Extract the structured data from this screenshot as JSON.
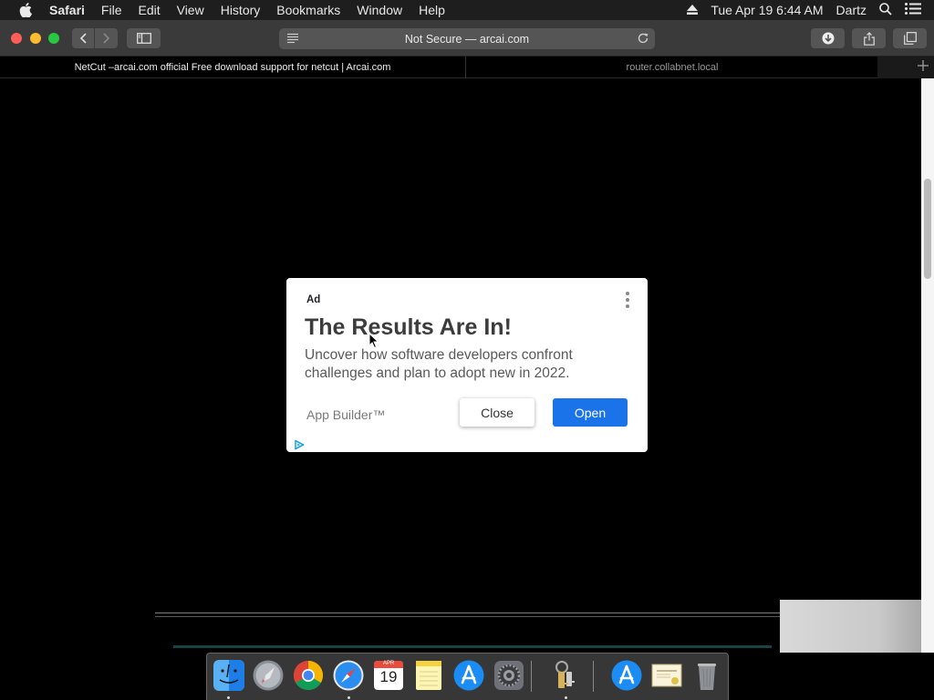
{
  "menubar": {
    "app_name": "Safari",
    "menus": [
      "File",
      "Edit",
      "View",
      "History",
      "Bookmarks",
      "Window",
      "Help"
    ],
    "datetime": "Tue Apr 19  6:44 AM",
    "user": "Dartz"
  },
  "toolbar": {
    "address_text": "Not Secure — arcai.com"
  },
  "tabs": [
    {
      "title": "NetCut –arcai.com official Free download support for netcut | Arcai.com",
      "active": true
    },
    {
      "title": "router.collabnet.local",
      "active": false
    }
  ],
  "ad": {
    "label": "Ad",
    "title": "The Results Are In!",
    "body": "Uncover how software developers confront challenges and plan to adopt new in 2022.",
    "brand": "App Builder™",
    "close_label": "Close",
    "open_label": "Open",
    "open_color": "#1a73e8"
  },
  "dock": {
    "apps": [
      "finder-icon",
      "launchpad-icon",
      "chrome-icon",
      "safari-icon",
      "calendar-icon",
      "notes-icon",
      "app-store-icon",
      "system-preferences-icon",
      "keychain-access-icon",
      "app-store-downloads-icon",
      "certificate-icon",
      "trash-icon"
    ],
    "calendar": {
      "month": "APR",
      "day": "19"
    }
  },
  "colors": {
    "menubar_bg": "#1e1e1e",
    "toolbar_bg": "#3a3a3a",
    "page_bg": "#000000"
  }
}
